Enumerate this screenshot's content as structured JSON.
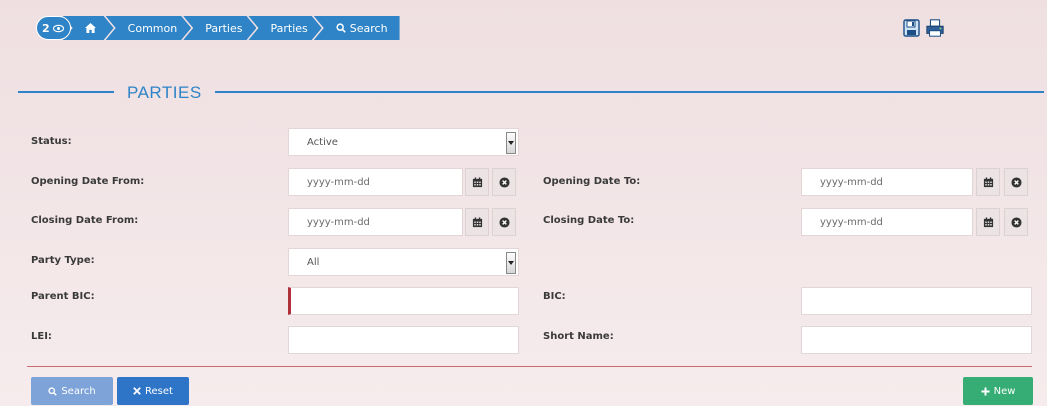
{
  "breadcrumb": {
    "count": "2",
    "items": [
      {
        "label": "Common"
      },
      {
        "label": "Parties"
      },
      {
        "label": "Parties"
      },
      {
        "label": "Search"
      }
    ]
  },
  "section": {
    "title": "PARTIES"
  },
  "form": {
    "status": {
      "label": "Status:",
      "value": "Active"
    },
    "opening_date_from": {
      "label": "Opening Date From:",
      "placeholder": "yyyy-mm-dd"
    },
    "opening_date_to": {
      "label": "Opening Date To:",
      "placeholder": "yyyy-mm-dd"
    },
    "closing_date_from": {
      "label": "Closing Date From:",
      "placeholder": "yyyy-mm-dd"
    },
    "closing_date_to": {
      "label": "Closing Date To:",
      "placeholder": "yyyy-mm-dd"
    },
    "party_type": {
      "label": "Party Type:",
      "value": "All"
    },
    "parent_bic": {
      "label": "Parent BIC:",
      "value": ""
    },
    "bic": {
      "label": "BIC:",
      "value": ""
    },
    "lei": {
      "label": "LEI:",
      "value": ""
    },
    "short_name": {
      "label": "Short Name:",
      "value": ""
    }
  },
  "actions": {
    "search": "Search",
    "reset": "Reset",
    "new": "New"
  },
  "colors": {
    "primary": "#2e84c6",
    "success": "#36ad74",
    "danger": "#b0303a",
    "background": "#efdfe1"
  },
  "icons": [
    "eye-icon",
    "home-icon",
    "search-icon",
    "save-icon",
    "print-icon",
    "calendar-icon",
    "clear-icon",
    "close-icon",
    "plus-icon"
  ]
}
